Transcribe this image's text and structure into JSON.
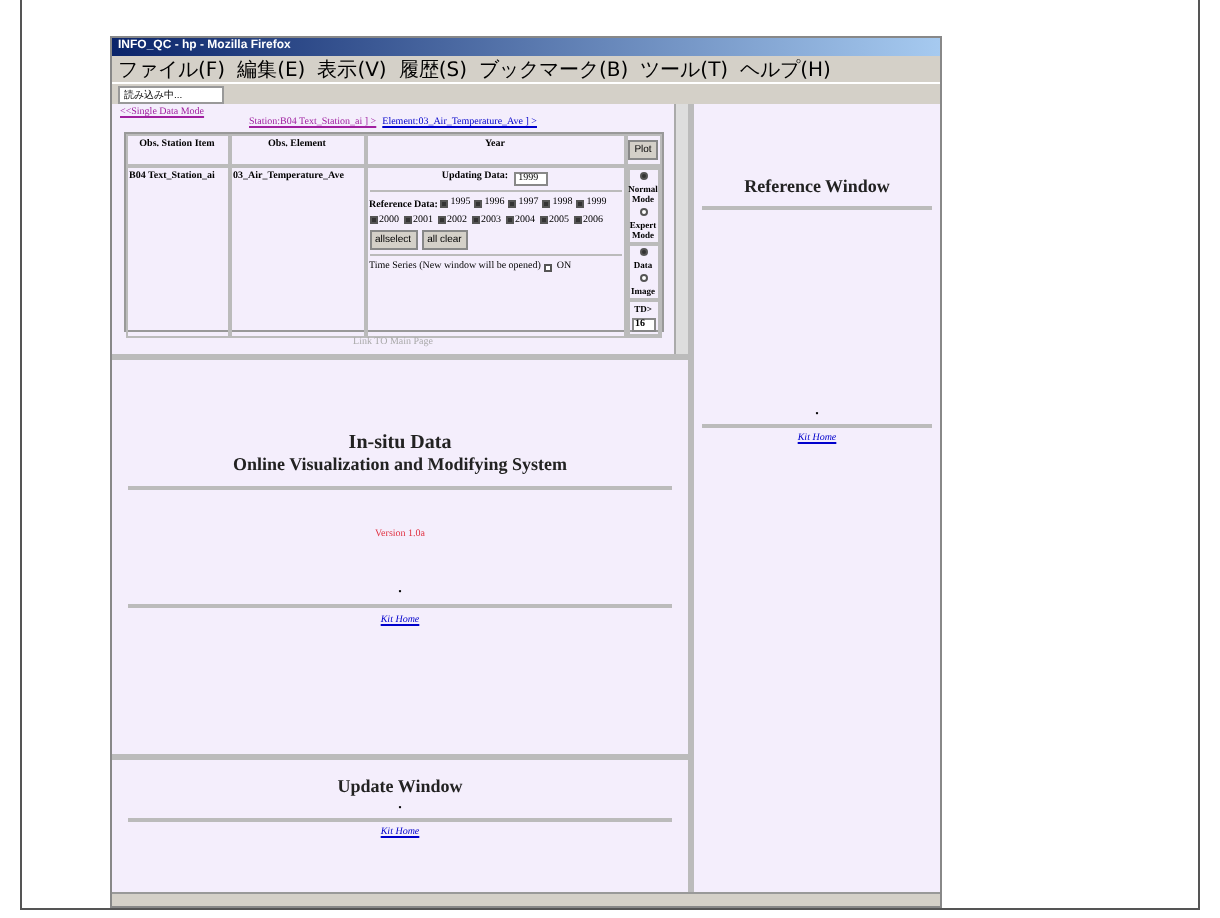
{
  "window": {
    "title": "INFO_QC - hp - Mozilla Firefox"
  },
  "menu": [
    "ファイル(F)",
    "編集(E)",
    "表示(V)",
    "履歴(S)",
    "ブックマーク(B)",
    "ツール(T)",
    "ヘルプ(H)"
  ],
  "toolbar": {
    "status_text": "読み込み中..."
  },
  "top_frame": {
    "mode_link": "<<Single Data Mode",
    "station_link": "Station:B04 Text_Station_ai ] >",
    "element_link": "Element:03_Air_Temperature_Ave ] >",
    "columns": [
      "Obs. Station Item",
      "Obs. Element",
      "Year"
    ],
    "plot_button": "Plot",
    "station": "B04 Text_Station_ai",
    "element": "03_Air_Temperature_Ave",
    "updating_label": "Updating Data:",
    "updating_value": "1999",
    "reference_label": "Reference Data:",
    "years": [
      {
        "label": "1995",
        "checked": true
      },
      {
        "label": "1996",
        "checked": true
      },
      {
        "label": "1997",
        "checked": true
      },
      {
        "label": "1998",
        "checked": true
      },
      {
        "label": "1999",
        "checked": true
      },
      {
        "label": "2000",
        "checked": true
      },
      {
        "label": "2001",
        "checked": true
      },
      {
        "label": "2002",
        "checked": true
      },
      {
        "label": "2003",
        "checked": true
      },
      {
        "label": "2004",
        "checked": true
      },
      {
        "label": "2005",
        "checked": true
      },
      {
        "label": "2006",
        "checked": true
      }
    ],
    "select_buttons": [
      "allselect",
      "all clear"
    ],
    "time_series_label": "Time Series (New window will be opened)",
    "time_series_checked": false,
    "time_series_on": "ON",
    "modes": [
      {
        "label": "Normal Mode",
        "selected": true
      },
      {
        "label": "Expert Mode",
        "selected": false
      }
    ],
    "outputs": [
      {
        "label": "Data",
        "selected": true
      },
      {
        "label": "Image",
        "selected": false
      }
    ],
    "td_label": "TD>",
    "td_value": "16",
    "footer_link": "Link TO Main Page"
  },
  "main_frame": {
    "title": "In-situ Data",
    "subtitle": "Online Visualization and Modifying System",
    "version": "Version 1.0a",
    "dot": ".",
    "link": "Kit Home"
  },
  "update_frame": {
    "title": "Update Window",
    "dot": ".",
    "link": "Kit Home"
  },
  "reference_frame": {
    "title": "Reference Window",
    "dot": ".",
    "link": "Kit Home"
  }
}
